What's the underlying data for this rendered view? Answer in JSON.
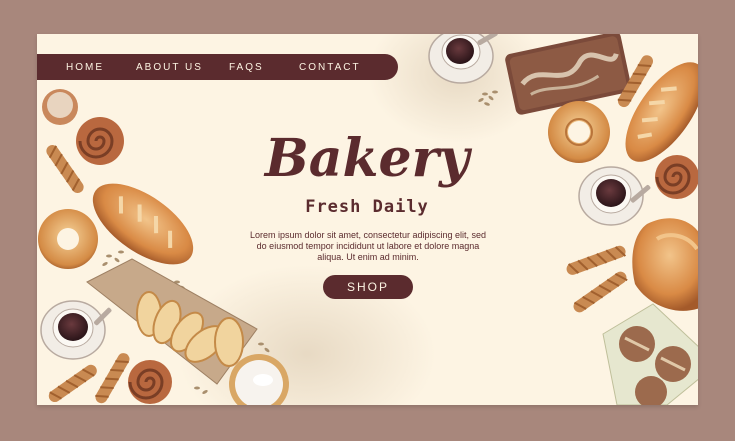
{
  "nav": {
    "items": [
      {
        "label": "HOME"
      },
      {
        "label": "ABOUT US"
      },
      {
        "label": "FAQS"
      },
      {
        "label": "CONTACT"
      }
    ]
  },
  "hero": {
    "title": "Bakery",
    "subtitle": "Fresh Daily",
    "body_line1": "Lorem ipsum dolor sit amet, consectetur adipiscing elit, sed",
    "body_line2": "do eiusmod tempor incididunt ut labore et dolore magna",
    "body_line3": "aliqua. Ut enim ad minim.",
    "cta_label": "SHOP"
  },
  "colors": {
    "page_background": "#a8877c",
    "card_background": "#fdf4e3",
    "brand": "#5b2b2e",
    "brand_text": "#fdf4e3"
  },
  "illustrations": [
    "coffee-cup-icon",
    "chocolate-loaf-icon",
    "twisted-breadstick-icon",
    "baguette-icon",
    "bagel-icon",
    "cinnamon-roll-icon",
    "muffin-icon",
    "bread-cutting-board-icon",
    "flour-bowl-icon",
    "buns-on-paper-icon",
    "seeds-icon"
  ]
}
